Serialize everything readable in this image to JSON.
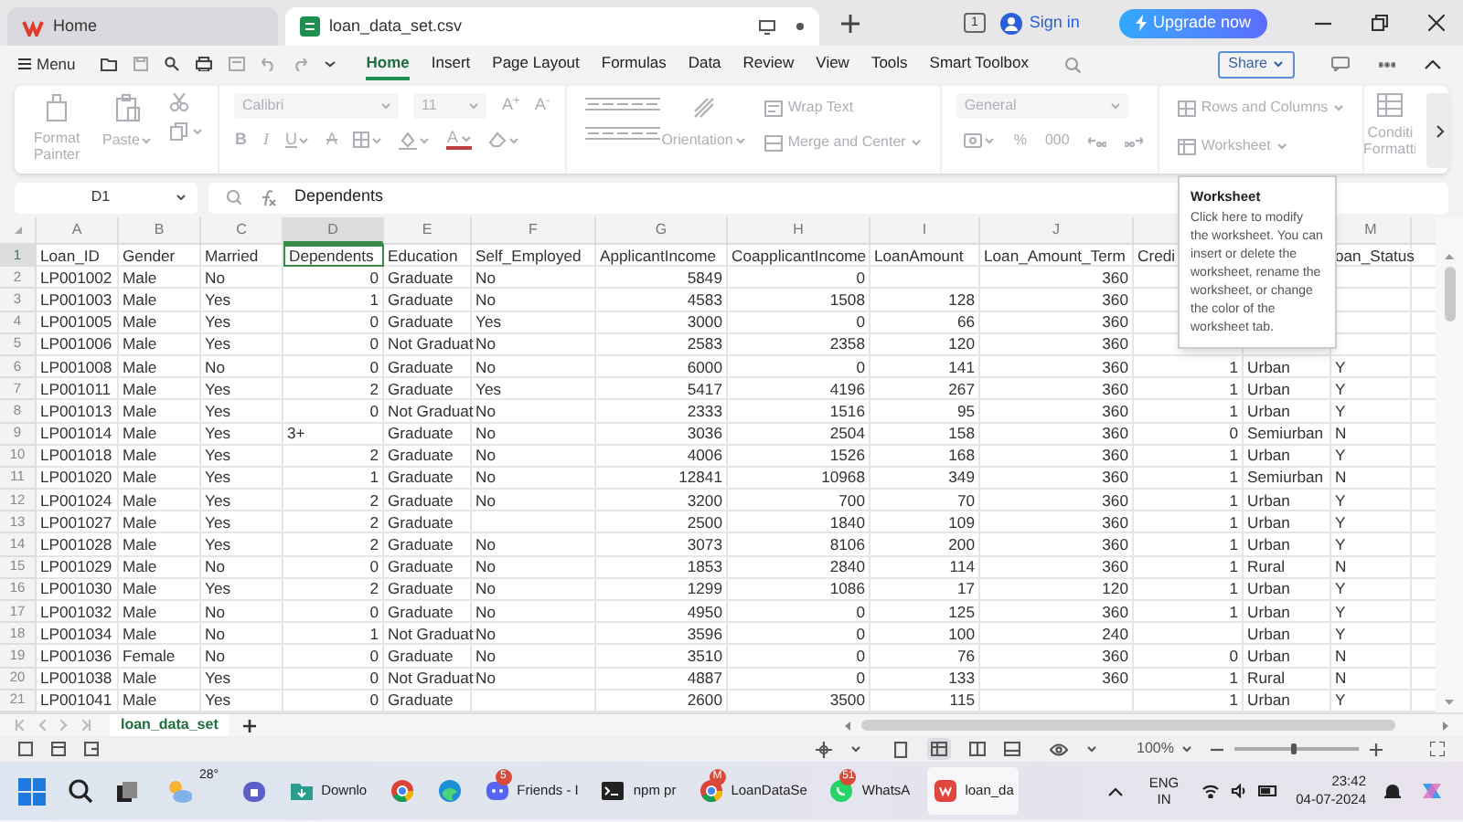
{
  "tabs": [
    {
      "label": "Home",
      "kind": "home",
      "selected": false
    },
    {
      "label": "loan_data_set.csv",
      "kind": "sheet",
      "selected": true
    }
  ],
  "title_bar": {
    "badge": "1",
    "sign_in": "Sign in",
    "upgrade": "Upgrade now"
  },
  "menu": {
    "label": "Menu",
    "share": "Share",
    "tabs": [
      {
        "label": "Home",
        "selected": true
      },
      {
        "label": "Insert",
        "selected": false
      },
      {
        "label": "Page Layout",
        "selected": false
      },
      {
        "label": "Formulas",
        "selected": false
      },
      {
        "label": "Data",
        "selected": false
      },
      {
        "label": "Review",
        "selected": false
      },
      {
        "label": "View",
        "selected": false
      },
      {
        "label": "Tools",
        "selected": false
      },
      {
        "label": "Smart Toolbox",
        "selected": false
      }
    ]
  },
  "ribbon": {
    "format_painter": "Format Painter",
    "paste": "Paste",
    "font": "Calibri",
    "font_size": "11",
    "size_buttons": [
      "A$^{+}$",
      "A$^{-}$"
    ],
    "format_buttons": [
      {
        "label": "B",
        "kind": "bold"
      },
      {
        "label": "I",
        "kind": "italic"
      },
      {
        "label": "U",
        "kind": "underline"
      },
      {
        "label": "A",
        "kind": "strike"
      },
      {
        "kind": "border"
      },
      {
        "kind": "fill"
      },
      {
        "label": "A",
        "kind": "color"
      },
      {
        "kind": "eraser"
      }
    ],
    "orientation": "Orientation",
    "wrap_text": "Wrap Text",
    "merge": "Merge and Center",
    "number_format": "General",
    "number_buttons": [
      "%",
      "000"
    ],
    "rows_columns": "Rows and Columns",
    "worksheet": "Worksheet",
    "conditional": "Conditi Formatti"
  },
  "formula_bar": {
    "cell": "D1",
    "formula": "Dependents"
  },
  "sheet": {
    "columns": [
      {
        "letter": "A",
        "selected": false
      },
      {
        "letter": "B",
        "selected": false
      },
      {
        "letter": "C",
        "selected": false
      },
      {
        "letter": "D",
        "selected": true
      },
      {
        "letter": "E",
        "selected": false
      },
      {
        "letter": "F",
        "selected": false
      },
      {
        "letter": "G",
        "selected": false
      },
      {
        "letter": "H",
        "selected": false
      },
      {
        "letter": "I",
        "selected": false
      },
      {
        "letter": "J",
        "selected": false
      },
      {},
      {},
      {
        "letter": "M",
        "selected": false
      }
    ],
    "rows": [
      {
        "number": "1",
        "selected": true,
        "cells": [
          "Loan_ID",
          "Gender",
          "Married",
          "Dependents",
          "Education",
          "Self_Employed",
          "ApplicantIncome",
          "CoapplicantIncome",
          "LoanAmount",
          "Loan_Amount_Term",
          "Credi",
          null,
          "oan_Status"
        ]
      },
      {
        "number": "2",
        "selected": false,
        "cells": [
          "LP001002",
          "Male",
          "No",
          "0",
          "Graduate",
          "No",
          "5849",
          "0",
          null,
          "360",
          null,
          null,
          null
        ]
      },
      {
        "number": "3",
        "selected": false,
        "cells": [
          "LP001003",
          "Male",
          "Yes",
          "1",
          "Graduate",
          "No",
          "4583",
          "1508",
          "128",
          "360",
          null,
          null,
          null
        ]
      },
      {
        "number": "4",
        "selected": false,
        "cells": [
          "LP001005",
          "Male",
          "Yes",
          "0",
          "Graduate",
          "Yes",
          "3000",
          "0",
          "66",
          "360",
          null,
          null,
          null
        ]
      },
      {
        "number": "5",
        "selected": false,
        "cells": [
          "LP001006",
          "Male",
          "Yes",
          "0",
          "Not Graduat",
          "No",
          "2583",
          "2358",
          "120",
          "360",
          null,
          null,
          null
        ]
      },
      {
        "number": "6",
        "selected": false,
        "cells": [
          "LP001008",
          "Male",
          "No",
          "0",
          "Graduate",
          "No",
          "6000",
          "0",
          "141",
          "360",
          "1",
          "Urban",
          "Y"
        ]
      },
      {
        "number": "7",
        "selected": false,
        "cells": [
          "LP001011",
          "Male",
          "Yes",
          "2",
          "Graduate",
          "Yes",
          "5417",
          "4196",
          "267",
          "360",
          "1",
          "Urban",
          "Y"
        ]
      },
      {
        "number": "8",
        "selected": false,
        "cells": [
          "LP001013",
          "Male",
          "Yes",
          "0",
          "Not Graduat",
          "No",
          "2333",
          "1516",
          "95",
          "360",
          "1",
          "Urban",
          "Y"
        ]
      },
      {
        "number": "9",
        "selected": false,
        "cells": [
          "LP001014",
          "Male",
          "Yes",
          "3+",
          "Graduate",
          "No",
          "3036",
          "2504",
          "158",
          "360",
          "0",
          "Semiurban",
          "N"
        ]
      },
      {
        "number": "10",
        "selected": false,
        "cells": [
          "LP001018",
          "Male",
          "Yes",
          "2",
          "Graduate",
          "No",
          "4006",
          "1526",
          "168",
          "360",
          "1",
          "Urban",
          "Y"
        ]
      },
      {
        "number": "11",
        "selected": false,
        "cells": [
          "LP001020",
          "Male",
          "Yes",
          "1",
          "Graduate",
          "No",
          "12841",
          "10968",
          "349",
          "360",
          "1",
          "Semiurban",
          "N"
        ]
      },
      {
        "number": "12",
        "selected": false,
        "cells": [
          "LP001024",
          "Male",
          "Yes",
          "2",
          "Graduate",
          "No",
          "3200",
          "700",
          "70",
          "360",
          "1",
          "Urban",
          "Y"
        ]
      },
      {
        "number": "13",
        "selected": false,
        "cells": [
          "LP001027",
          "Male",
          "Yes",
          "2",
          "Graduate",
          null,
          "2500",
          "1840",
          "109",
          "360",
          "1",
          "Urban",
          "Y"
        ]
      },
      {
        "number": "14",
        "selected": false,
        "cells": [
          "LP001028",
          "Male",
          "Yes",
          "2",
          "Graduate",
          "No",
          "3073",
          "8106",
          "200",
          "360",
          "1",
          "Urban",
          "Y"
        ]
      },
      {
        "number": "15",
        "selected": false,
        "cells": [
          "LP001029",
          "Male",
          "No",
          "0",
          "Graduate",
          "No",
          "1853",
          "2840",
          "114",
          "360",
          "1",
          "Rural",
          "N"
        ]
      },
      {
        "number": "16",
        "selected": false,
        "cells": [
          "LP001030",
          "Male",
          "Yes",
          "2",
          "Graduate",
          "No",
          "1299",
          "1086",
          "17",
          "120",
          "1",
          "Urban",
          "Y"
        ]
      },
      {
        "number": "17",
        "selected": false,
        "cells": [
          "LP001032",
          "Male",
          "No",
          "0",
          "Graduate",
          "No",
          "4950",
          "0",
          "125",
          "360",
          "1",
          "Urban",
          "Y"
        ]
      },
      {
        "number": "18",
        "selected": false,
        "cells": [
          "LP001034",
          "Male",
          "No",
          "1",
          "Not Graduat",
          "No",
          "3596",
          "0",
          "100",
          "240",
          null,
          "Urban",
          "Y"
        ]
      },
      {
        "number": "19",
        "selected": false,
        "cells": [
          "LP001036",
          "Female",
          "No",
          "0",
          "Graduate",
          "No",
          "3510",
          "0",
          "76",
          "360",
          "0",
          "Urban",
          "N"
        ]
      },
      {
        "number": "20",
        "selected": false,
        "cells": [
          "LP001038",
          "Male",
          "Yes",
          "0",
          "Not Graduat",
          "No",
          "4887",
          "0",
          "133",
          "360",
          "1",
          "Rural",
          "N"
        ]
      },
      {
        "number": "21",
        "selected": false,
        "cells": [
          "LP001041",
          "Male",
          "Yes",
          "0",
          "Graduate",
          null,
          "2600",
          "3500",
          "115",
          null,
          "1",
          "Urban",
          "Y"
        ]
      }
    ]
  },
  "tooltip": {
    "title": "Worksheet",
    "text": "Click here to modify the worksheet. You can insert or delete the worksheet, rename the worksheet, or change the color of the worksheet tab."
  },
  "sheet_tabs": [
    {
      "label": "loan_data_set",
      "selected": true
    }
  ],
  "status_bar": {
    "zoom": "100%",
    "zoom_slider": {
      "level": 0.45
    }
  },
  "taskbar": {
    "apps": [
      {
        "kind": "weather",
        "label": "28°",
        "selected": false
      },
      {
        "kind": "meet",
        "selected": false
      },
      {
        "kind": "folder",
        "label": "Downlo",
        "selected": false
      },
      {
        "kind": "chrome",
        "selected": false
      },
      {
        "kind": "edge",
        "selected": false
      },
      {
        "kind": "discord",
        "label": "Friends - I",
        "badge": "5",
        "selected": false
      },
      {
        "kind": "terminal",
        "label": "npm pr",
        "selected": false
      },
      {
        "kind": "chrome",
        "label": "LoanDataSe",
        "badge": "M",
        "selected": false
      },
      {
        "kind": "whatsapp",
        "label": "WhatsA",
        "badge": "51",
        "selected": false
      },
      {
        "kind": "wps",
        "label": "loan_da",
        "selected": true
      }
    ],
    "language": "ENG",
    "region": "IN",
    "time": "23:42",
    "date": "04-07-2024"
  }
}
